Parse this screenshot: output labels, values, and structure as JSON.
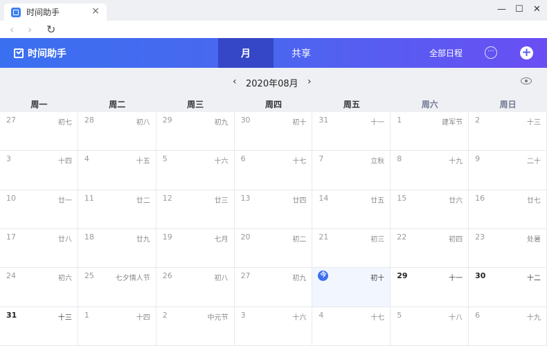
{
  "browser": {
    "tab_title": "时间助手",
    "tab_icon": "calendar-check-icon",
    "close_glyph": "×",
    "minimize_glyph": "—",
    "maximize_glyph": "☐",
    "window_close_glyph": "✕",
    "back_glyph": "‹",
    "forward_glyph": "›",
    "reload_glyph": "↻"
  },
  "header": {
    "brand": "时间助手",
    "tabs": [
      {
        "label": "月",
        "active": true
      },
      {
        "label": "共享",
        "active": false
      }
    ],
    "all_schedules": "全部日程",
    "more_glyph": "···",
    "add_glyph": "+"
  },
  "month_nav": {
    "prev_glyph": "‹",
    "label": "2020年08月",
    "next_glyph": "›",
    "eye_icon": "eye-icon"
  },
  "weekdays": [
    "周一",
    "周二",
    "周三",
    "周四",
    "周五",
    "周六",
    "周日"
  ],
  "today_label": "今",
  "colors": {
    "accent": "#3d6ff0",
    "header_start": "#3a6ff0",
    "header_end": "#6a4ef4",
    "active_tab": "#3547c6"
  },
  "weeks": [
    [
      {
        "d": "27",
        "l": "初七",
        "cur": false
      },
      {
        "d": "28",
        "l": "初八",
        "cur": false
      },
      {
        "d": "29",
        "l": "初九",
        "cur": false
      },
      {
        "d": "30",
        "l": "初十",
        "cur": false
      },
      {
        "d": "31",
        "l": "十一",
        "cur": false
      },
      {
        "d": "1",
        "l": "建军节",
        "cur": false
      },
      {
        "d": "2",
        "l": "十三",
        "cur": false
      }
    ],
    [
      {
        "d": "3",
        "l": "十四",
        "cur": false
      },
      {
        "d": "4",
        "l": "十五",
        "cur": false
      },
      {
        "d": "5",
        "l": "十六",
        "cur": false
      },
      {
        "d": "6",
        "l": "十七",
        "cur": false
      },
      {
        "d": "7",
        "l": "立秋",
        "cur": false
      },
      {
        "d": "8",
        "l": "十九",
        "cur": false
      },
      {
        "d": "9",
        "l": "二十",
        "cur": false
      }
    ],
    [
      {
        "d": "10",
        "l": "廿一",
        "cur": false
      },
      {
        "d": "11",
        "l": "廿二",
        "cur": false
      },
      {
        "d": "12",
        "l": "廿三",
        "cur": false
      },
      {
        "d": "13",
        "l": "廿四",
        "cur": false
      },
      {
        "d": "14",
        "l": "廿五",
        "cur": false
      },
      {
        "d": "15",
        "l": "廿六",
        "cur": false
      },
      {
        "d": "16",
        "l": "廿七",
        "cur": false
      }
    ],
    [
      {
        "d": "17",
        "l": "廿八",
        "cur": false
      },
      {
        "d": "18",
        "l": "廿九",
        "cur": false
      },
      {
        "d": "19",
        "l": "七月",
        "cur": false
      },
      {
        "d": "20",
        "l": "初二",
        "cur": false
      },
      {
        "d": "21",
        "l": "初三",
        "cur": false
      },
      {
        "d": "22",
        "l": "初四",
        "cur": false
      },
      {
        "d": "23",
        "l": "处暑",
        "cur": false
      }
    ],
    [
      {
        "d": "24",
        "l": "初六",
        "cur": false
      },
      {
        "d": "25",
        "l": "七夕情人节",
        "cur": false
      },
      {
        "d": "26",
        "l": "初八",
        "cur": false
      },
      {
        "d": "27",
        "l": "初九",
        "cur": false
      },
      {
        "d": "",
        "l": "初十",
        "cur": true,
        "today": true
      },
      {
        "d": "29",
        "l": "十一",
        "cur": true
      },
      {
        "d": "30",
        "l": "十二",
        "cur": true
      }
    ],
    [
      {
        "d": "31",
        "l": "十三",
        "cur": true
      },
      {
        "d": "1",
        "l": "十四",
        "cur": false
      },
      {
        "d": "2",
        "l": "中元节",
        "cur": false
      },
      {
        "d": "3",
        "l": "十六",
        "cur": false
      },
      {
        "d": "4",
        "l": "十七",
        "cur": false
      },
      {
        "d": "5",
        "l": "十八",
        "cur": false
      },
      {
        "d": "6",
        "l": "十九",
        "cur": false
      }
    ]
  ]
}
